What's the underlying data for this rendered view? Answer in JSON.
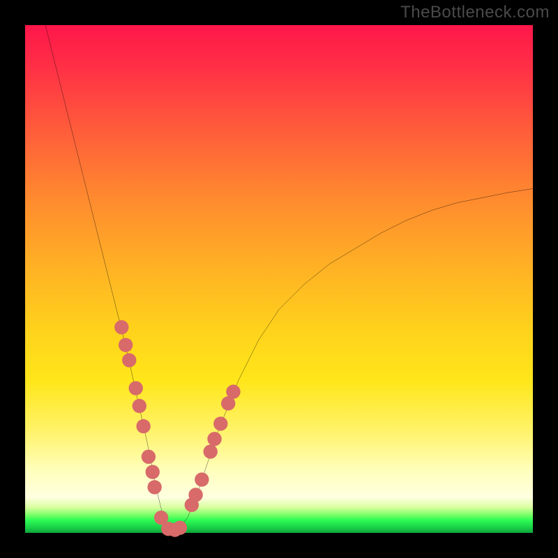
{
  "watermark": "TheBottleneck.com",
  "chart_data": {
    "type": "line",
    "title": "",
    "xlabel": "",
    "ylabel": "",
    "xlim": [
      0,
      100
    ],
    "ylim": [
      0,
      100
    ],
    "curve": {
      "name": "bottleneck-curve",
      "x": [
        4,
        6,
        8,
        10,
        12,
        14,
        16,
        18,
        20,
        22,
        24,
        25,
        26,
        27,
        28,
        29,
        30,
        32,
        34,
        36,
        38,
        42,
        46,
        50,
        55,
        60,
        65,
        70,
        75,
        80,
        85,
        90,
        95,
        100
      ],
      "y": [
        100,
        92,
        84,
        76,
        68,
        60,
        52,
        44,
        36,
        27,
        18,
        13,
        8,
        4,
        1.5,
        0.5,
        0.5,
        3,
        8,
        14,
        20,
        30,
        38,
        44,
        49,
        53,
        56,
        59,
        61.5,
        63.5,
        65,
        66,
        67,
        67.8
      ]
    },
    "markers": {
      "name": "highlight-dots",
      "color": "#d86a6a",
      "radius": 1.4,
      "points": [
        {
          "x": 19.0,
          "y": 40.5
        },
        {
          "x": 19.8,
          "y": 37.0
        },
        {
          "x": 20.5,
          "y": 34.0
        },
        {
          "x": 21.8,
          "y": 28.5
        },
        {
          "x": 22.5,
          "y": 25.0
        },
        {
          "x": 23.3,
          "y": 21.0
        },
        {
          "x": 24.3,
          "y": 15.0
        },
        {
          "x": 25.1,
          "y": 12.0
        },
        {
          "x": 25.5,
          "y": 9.0
        },
        {
          "x": 26.8,
          "y": 3.0
        },
        {
          "x": 28.2,
          "y": 0.8
        },
        {
          "x": 29.5,
          "y": 0.6
        },
        {
          "x": 30.5,
          "y": 1.0
        },
        {
          "x": 32.8,
          "y": 5.5
        },
        {
          "x": 33.6,
          "y": 7.5
        },
        {
          "x": 34.8,
          "y": 10.5
        },
        {
          "x": 36.5,
          "y": 16.0
        },
        {
          "x": 37.3,
          "y": 18.5
        },
        {
          "x": 38.5,
          "y": 21.5
        },
        {
          "x": 40.0,
          "y": 25.5
        },
        {
          "x": 41.0,
          "y": 27.8
        }
      ]
    },
    "gradient_bands": [
      {
        "stop": 0,
        "color": "#ff164a"
      },
      {
        "stop": 50,
        "color": "#ffb224"
      },
      {
        "stop": 80,
        "color": "#fff36a"
      },
      {
        "stop": 96,
        "color": "#77ff66"
      },
      {
        "stop": 100,
        "color": "#0fa53b"
      }
    ]
  }
}
